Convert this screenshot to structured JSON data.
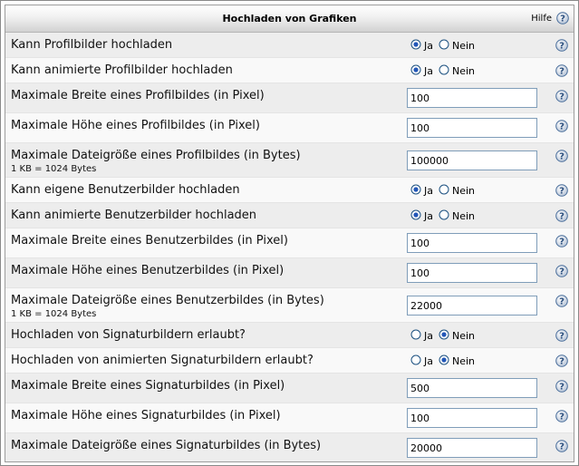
{
  "header": {
    "title": "Hochladen von Grafiken",
    "help_label": "Hilfe"
  },
  "options": {
    "yes": "Ja",
    "no": "Nein"
  },
  "settings": [
    {
      "label": "Kann Profilbilder hochladen",
      "type": "radio",
      "value": "yes"
    },
    {
      "label": "Kann animierte Profilbilder hochladen",
      "type": "radio",
      "value": "yes"
    },
    {
      "label": "Maximale Breite eines Profilbildes (in Pixel)",
      "type": "text",
      "value": "100"
    },
    {
      "label": "Maximale Höhe eines Profilbildes (in Pixel)",
      "type": "text",
      "value": "100"
    },
    {
      "label": "Maximale Dateigröße eines Profilbildes (in Bytes)",
      "note": "1 KB = 1024 Bytes",
      "type": "text",
      "value": "100000"
    },
    {
      "label": "Kann eigene Benutzerbilder hochladen",
      "type": "radio",
      "value": "yes"
    },
    {
      "label": "Kann animierte Benutzerbilder hochladen",
      "type": "radio",
      "value": "yes"
    },
    {
      "label": "Maximale Breite eines Benutzerbildes (in Pixel)",
      "type": "text",
      "value": "100"
    },
    {
      "label": "Maximale Höhe eines Benutzerbildes (in Pixel)",
      "type": "text",
      "value": "100"
    },
    {
      "label": "Maximale Dateigröße eines Benutzerbildes (in Bytes)",
      "note": "1 KB = 1024 Bytes",
      "type": "text",
      "value": "22000"
    },
    {
      "label": "Hochladen von Signaturbildern erlaubt?",
      "type": "radio",
      "value": "no"
    },
    {
      "label": "Hochladen von animierten Signaturbildern erlaubt?",
      "type": "radio",
      "value": "no"
    },
    {
      "label": "Maximale Breite eines Signaturbildes (in Pixel)",
      "type": "text",
      "value": "500"
    },
    {
      "label": "Maximale Höhe eines Signaturbildes (in Pixel)",
      "type": "text",
      "value": "100"
    },
    {
      "label": "Maximale Dateigröße eines Signaturbildes (in Bytes)",
      "type": "text",
      "value": "20000"
    }
  ],
  "icons": {
    "help": "help-question-icon",
    "radio": "radio-button-icon"
  },
  "colors": {
    "help_icon": "#4a6e9b",
    "radio_selected": "#2357b8",
    "input_border": "#7f9db9"
  }
}
